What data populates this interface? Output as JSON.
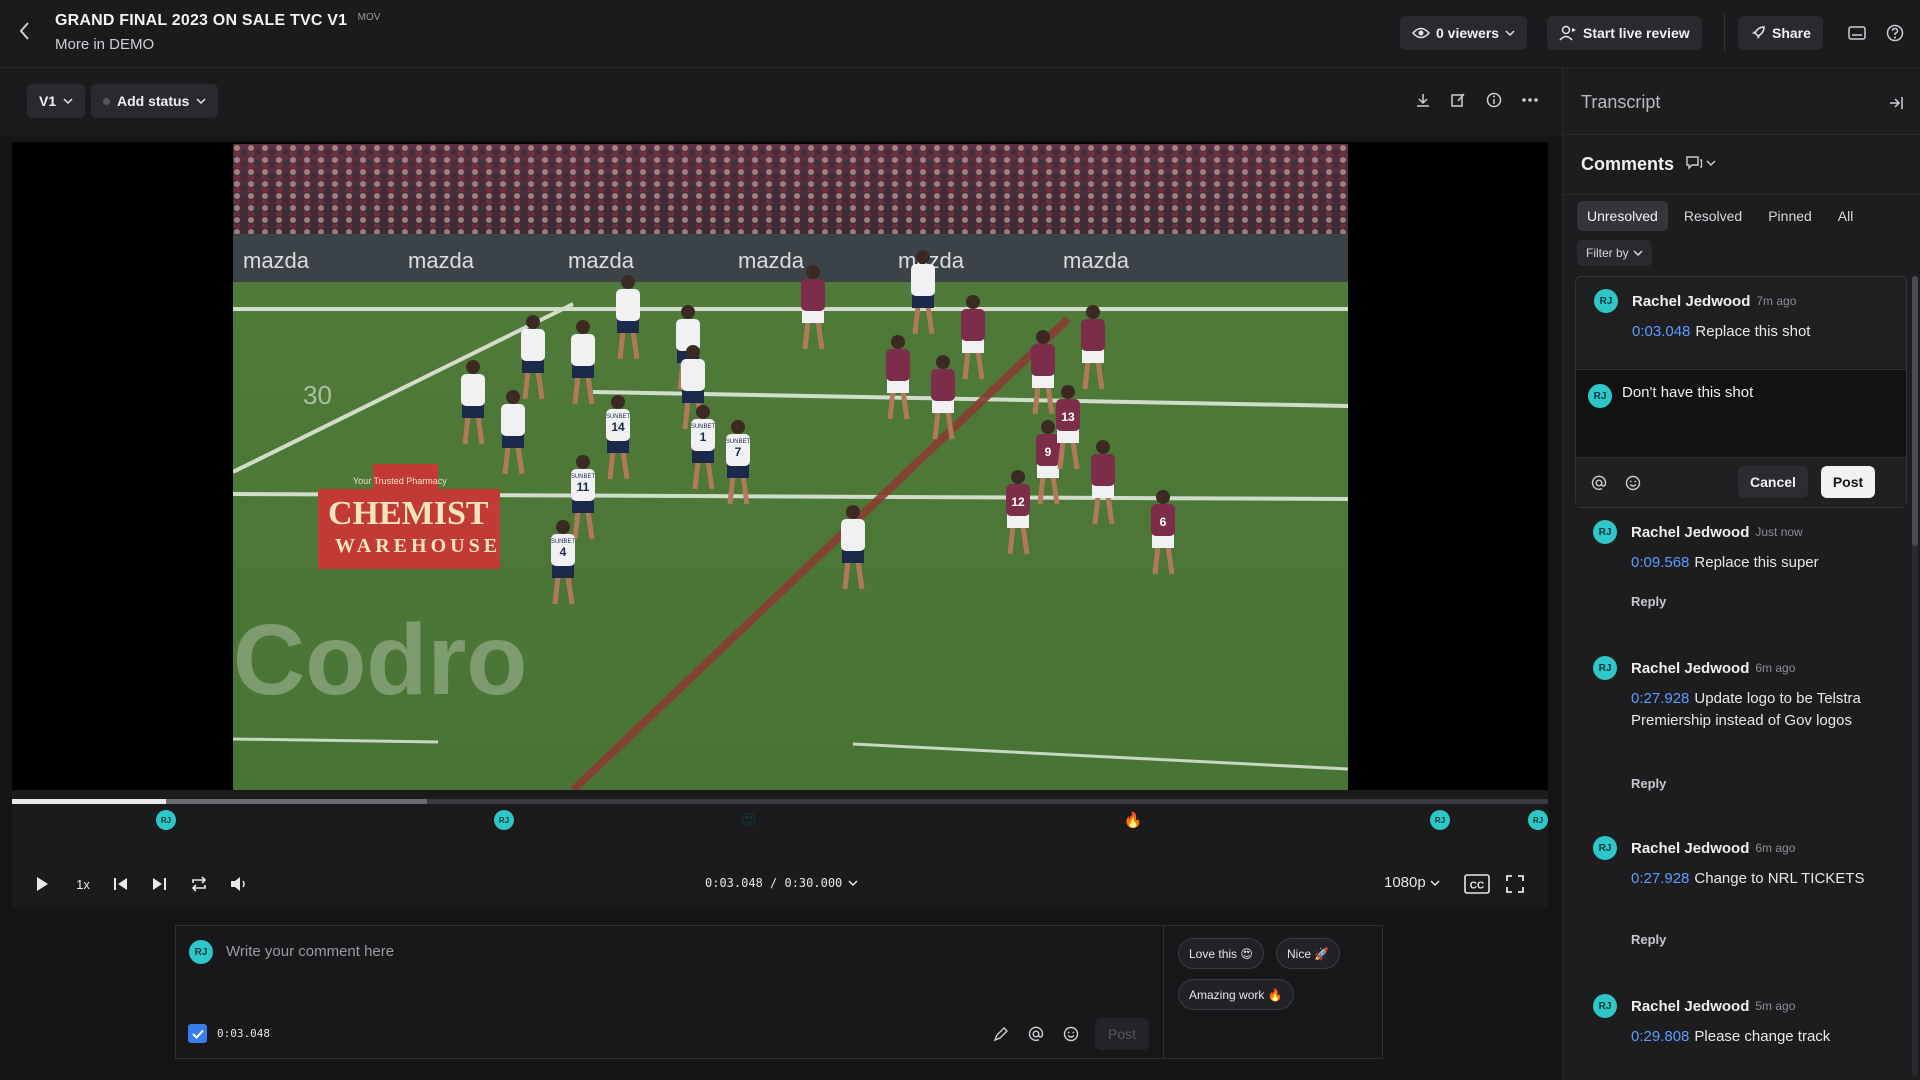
{
  "header": {
    "title": "GRAND FINAL 2023 ON SALE TVC V1",
    "file_ext": "MOV",
    "subtitle": "More in DEMO",
    "viewers_label": "0 viewers",
    "live_review_label": "Start live review",
    "share_label": "Share"
  },
  "toolbar": {
    "version_label": "V1",
    "status_label": "Add status"
  },
  "player": {
    "timecode": "0:03.048 / 0:30.000",
    "speed": "1x",
    "quality": "1080p",
    "progress": 0.1,
    "buffered": 0.27,
    "cc_label": "CC",
    "video": {
      "board_text": "mazda",
      "sponsor_line": "Your Trusted Pharmacy",
      "sponsor_name": "CHEMIST",
      "sponsor_sub": "WAREHOUSE",
      "watermark": "Codro",
      "field_number": "30",
      "jerseys": [
        "14",
        "1",
        "7",
        "11",
        "4",
        "9",
        "12",
        "13",
        "6"
      ],
      "jersey_brand": "SUNBET"
    },
    "markers": [
      {
        "type": "avatar",
        "label": "RJ",
        "pos": 0.1
      },
      {
        "type": "avatar",
        "label": "RJ",
        "pos": 0.32
      },
      {
        "type": "emoji",
        "label": "😍",
        "pos": 0.48
      },
      {
        "type": "emoji",
        "label": "🔥",
        "pos": 0.73
      },
      {
        "type": "avatar",
        "label": "RJ",
        "pos": 0.93
      },
      {
        "type": "avatar",
        "label": "RJ",
        "pos": 0.999
      }
    ]
  },
  "composer": {
    "avatar": "RJ",
    "placeholder": "Write your comment here",
    "timestamp": "0:03.048",
    "post_label": "Post",
    "quick_replies": [
      "Love this 😍",
      "Nice 🚀",
      "Amazing work 🔥"
    ]
  },
  "panel": {
    "transcript_label": "Transcript",
    "comments_label": "Comments",
    "tabs": [
      "Unresolved",
      "Resolved",
      "Pinned",
      "All"
    ],
    "filter_label": "Filter by",
    "reply_editor": {
      "avatar": "RJ",
      "text": "Don't have this shot",
      "cancel_label": "Cancel",
      "post_label": "Post"
    },
    "comments": [
      {
        "avatar": "RJ",
        "author": "Rachel Jedwood",
        "time": "7m ago",
        "stamp": "0:03.048",
        "text": "Replace this shot"
      },
      {
        "avatar": "RJ",
        "author": "Rachel Jedwood",
        "time": "Just now",
        "stamp": "0:09.568",
        "text": "Replace this super",
        "reply": "Reply"
      },
      {
        "avatar": "RJ",
        "author": "Rachel Jedwood",
        "time": "6m ago",
        "stamp": "0:27.928",
        "text": "Update logo to be Telstra Premiership instead of Gov logos",
        "reply": "Reply"
      },
      {
        "avatar": "RJ",
        "author": "Rachel Jedwood",
        "time": "6m ago",
        "stamp": "0:27.928",
        "text": "Change to NRL TICKETS",
        "reply": "Reply"
      },
      {
        "avatar": "RJ",
        "author": "Rachel Jedwood",
        "time": "5m ago",
        "stamp": "0:29.808",
        "text": "Please change track"
      }
    ]
  },
  "colors": {
    "accent": "#2fc6c8",
    "link": "#5b9cff",
    "checkbox": "#3a7bf0",
    "field": "#4e7a3a",
    "home_jersey": "#f1f1f3",
    "away_jersey": "#7b2d4a"
  }
}
